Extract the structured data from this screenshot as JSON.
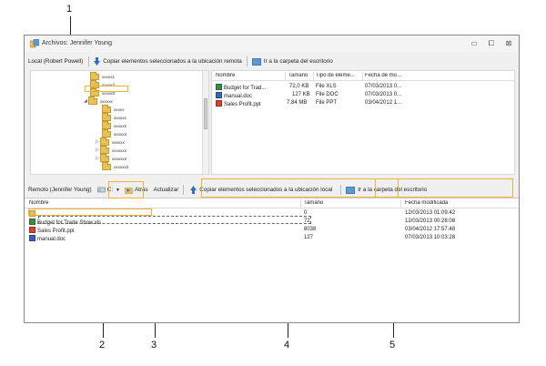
{
  "callouts": [
    "1",
    "2",
    "3",
    "4",
    "5"
  ],
  "window": {
    "title": "Archivos: Jennifer Young",
    "controls": {
      "minimize": "▭",
      "maximize": "⧠",
      "close": "⊠"
    }
  },
  "local_toolbar": {
    "label": "Local (Robert Powell)",
    "copy_remote": "Copiar elementos seleccionados a la ubicación remota",
    "go_desktop": "Ir a la carpeta del escritorio"
  },
  "tree": {
    "items": [
      "xxxxx1",
      "xxxxx2",
      "xxxxx3",
      "xxxxxx",
      "xxxxx",
      "xxxxx1",
      "xxxxx2",
      "xxxxx3",
      "xxxxxx",
      "xxxxxx1",
      "xxxxxx2",
      "xxxxxx3"
    ]
  },
  "local_list": {
    "headers": [
      "Nombre",
      "Tamaño",
      "Tipo de eleme...",
      "Fecha de mo..."
    ],
    "rows": [
      {
        "icon": "xls-file-icon",
        "name": "Budget for Trad...",
        "size": "72,0 KB",
        "type": "File XLS",
        "date": "07/03/2013 0..."
      },
      {
        "icon": "doc-file-icon",
        "name": "manual.doc",
        "size": "127 KB",
        "type": "File DOC",
        "date": "07/03/2013 0..."
      },
      {
        "icon": "ppt-file-icon",
        "name": "Sales Profit.ppt",
        "size": "7,84 MB",
        "type": "File PPT",
        "date": "03/04/2012 1..."
      }
    ]
  },
  "remote_toolbar": {
    "label": "Remoto (Jennifer Young)",
    "drive": "C:",
    "back": "Atrás",
    "refresh": "Actualizar",
    "copy_local": "Copiar elementos seleccionados a la ubicación local",
    "go_desktop": "Ir a la carpeta del escritorio"
  },
  "remote_list": {
    "headers": [
      "Nombre",
      "Tamaño",
      "Fecha modificada"
    ],
    "rows": [
      {
        "icon": "parent-folder-icon",
        "name": "..",
        "size": "0",
        "date": "12/03/2013 01:09:42"
      },
      {
        "icon": "xls-file-icon",
        "name": "Budget for Trade Show.xls",
        "size": "72",
        "date": "12/03/2013 00:28:08"
      },
      {
        "icon": "ppt-file-icon",
        "name": "Sales Profit.ppt",
        "size": "8038",
        "date": "03/04/2012 17:57:48"
      },
      {
        "icon": "doc-file-icon",
        "name": "manual.doc",
        "size": "127",
        "date": "07/03/2013 10:03:28"
      }
    ]
  },
  "colors": {
    "highlight": "#f2b233",
    "folder": "#e9c15a",
    "accent_blue": "#2f6fc9"
  }
}
